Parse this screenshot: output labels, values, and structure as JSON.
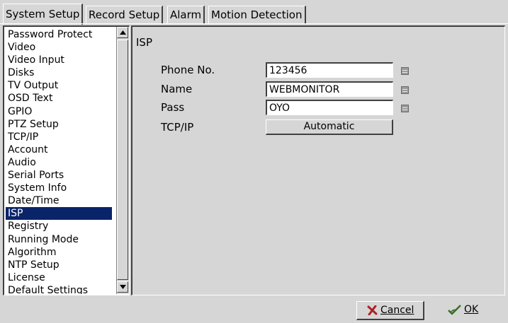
{
  "tabs": [
    {
      "label": "System Setup"
    },
    {
      "label": "Record Setup"
    },
    {
      "label": "Alarm"
    },
    {
      "label": "Motion Detection"
    }
  ],
  "menu": {
    "items": [
      {
        "label": "Password Protect"
      },
      {
        "label": "Video"
      },
      {
        "label": "Video Input"
      },
      {
        "label": "Disks"
      },
      {
        "label": "TV Output"
      },
      {
        "label": "OSD Text"
      },
      {
        "label": "GPIO"
      },
      {
        "label": "PTZ Setup"
      },
      {
        "label": "TCP/IP"
      },
      {
        "label": "Account"
      },
      {
        "label": "Audio"
      },
      {
        "label": "Serial Ports"
      },
      {
        "label": "System Info"
      },
      {
        "label": "Date/Time"
      },
      {
        "label": "ISP"
      },
      {
        "label": "Registry"
      },
      {
        "label": "Running Mode"
      },
      {
        "label": "Algorithm"
      },
      {
        "label": "NTP Setup"
      },
      {
        "label": "License"
      },
      {
        "label": "Default Settings"
      }
    ],
    "selected": "ISP"
  },
  "isp": {
    "title": "ISP",
    "phone_label": "Phone No.",
    "phone_value": "123456",
    "name_label": "Name",
    "name_value": "WEBMONITOR",
    "pass_label": "Pass",
    "pass_value": "OYO",
    "tcpip_label": "TCP/IP",
    "tcpip_value": "Automatic"
  },
  "footer": {
    "cancel_label": "Cancel",
    "ok_label": "OK"
  },
  "colors": {
    "background": "#d6d6d6",
    "selection": "#0a246a",
    "cancel_icon": "#b02020",
    "ok_icon": "#3a6e2a"
  },
  "icons": {
    "keyboard": "keyboard-icon",
    "cancel": "x-icon",
    "ok": "check-icon"
  }
}
